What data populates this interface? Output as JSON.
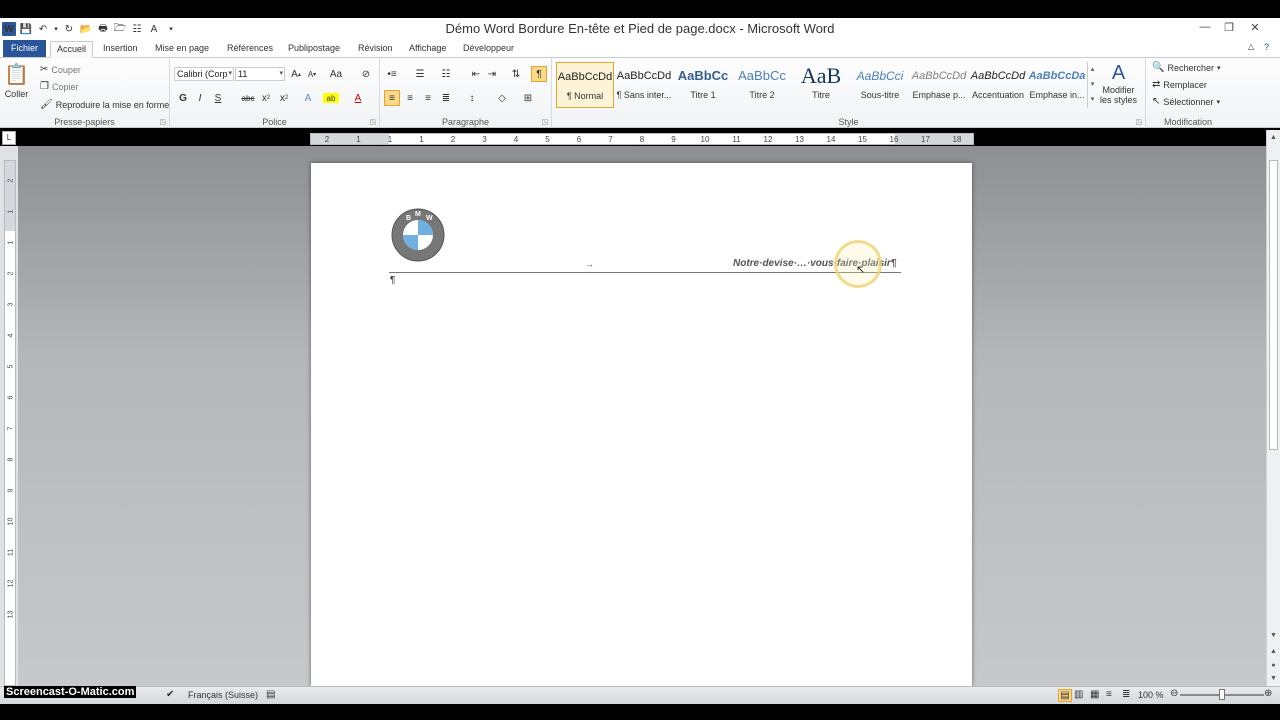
{
  "window": {
    "title": "Démo Word Bordure En-tête et Pied de page.docx - Microsoft Word",
    "app_icon": "W"
  },
  "tabs": [
    "Fichier",
    "Accueil",
    "Insertion",
    "Mise en page",
    "Références",
    "Publipostage",
    "Révision",
    "Affichage",
    "Développeur"
  ],
  "active_tab": "Accueil",
  "clipboard": {
    "paste_label": "Coller",
    "cut_label": "Couper",
    "copy_label": "Copier",
    "format_painter_label": "Reproduire la mise en forme",
    "group_label": "Presse-papiers"
  },
  "font": {
    "font_name": "Calibri (Corp",
    "font_size": "11",
    "bold": "G",
    "italic": "I",
    "underline": "S",
    "strike": "abc",
    "group_label": "Police"
  },
  "paragraph": {
    "group_label": "Paragraphe"
  },
  "styles": {
    "items": [
      {
        "sample": "AaBbCcDd",
        "name": "¶ Normal"
      },
      {
        "sample": "AaBbCcDd",
        "name": "¶ Sans inter..."
      },
      {
        "sample": "AaBbCc",
        "name": "Titre 1"
      },
      {
        "sample": "AaBbCc",
        "name": "Titre 2"
      },
      {
        "sample": "AaB",
        "name": "Titre"
      },
      {
        "sample": "AaBbCci",
        "name": "Sous-titre"
      },
      {
        "sample": "AaBbCcDd",
        "name": "Emphase p..."
      },
      {
        "sample": "AaBbCcDd",
        "name": "Accentuation"
      },
      {
        "sample": "AaBbCcDa",
        "name": "Emphase in..."
      }
    ],
    "change_styles_line1": "Modifier",
    "change_styles_line2": "les styles",
    "group_label": "Style"
  },
  "editing": {
    "find_label": "Rechercher",
    "replace_label": "Remplacer",
    "select_label": "Sélectionner",
    "group_label": "Modification"
  },
  "ruler": {
    "corner": "L",
    "ticks": [
      "2",
      "1",
      "1",
      "1",
      "2",
      "3",
      "4",
      "5",
      "6",
      "7",
      "8",
      "9",
      "10",
      "11",
      "12",
      "13",
      "14",
      "15",
      "16",
      "17",
      "18"
    ]
  },
  "document": {
    "logo_letters": [
      "B",
      "M",
      "W"
    ],
    "tab_mark": "→",
    "header_text": "Notre·devise·…·vous·faire·plaisir¶",
    "empty_paragraph": "¶"
  },
  "statusbar": {
    "language": "Français (Suisse)",
    "zoom": "100 %",
    "watermark": "Screencast-O-Matic.com"
  }
}
